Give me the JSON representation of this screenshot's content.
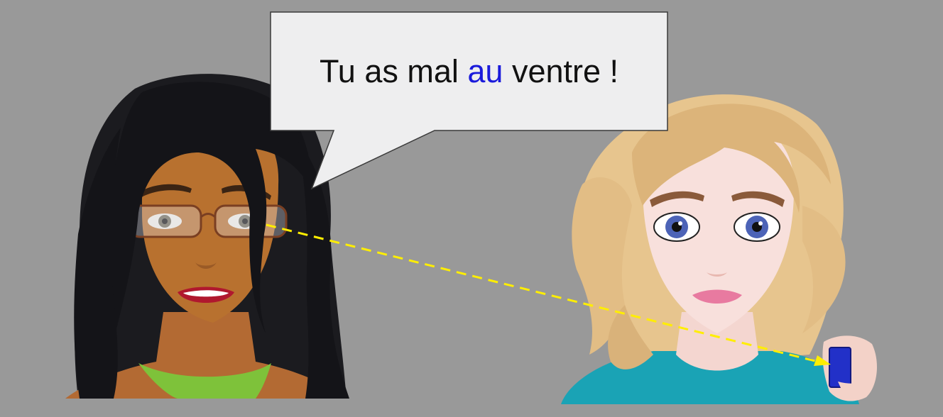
{
  "speech_bubble": {
    "before": "Tu as mal ",
    "highlight": "au",
    "after": " ventre !",
    "highlight_color": "#1a1adb"
  },
  "scene": {
    "background_color": "#999999",
    "left_character": "woman-with-glasses-and-black-hair",
    "right_character": "blonde-woman-holding-blue-block",
    "gaze_line_color": "#ffee00",
    "held_object_color": "#2230c8"
  }
}
